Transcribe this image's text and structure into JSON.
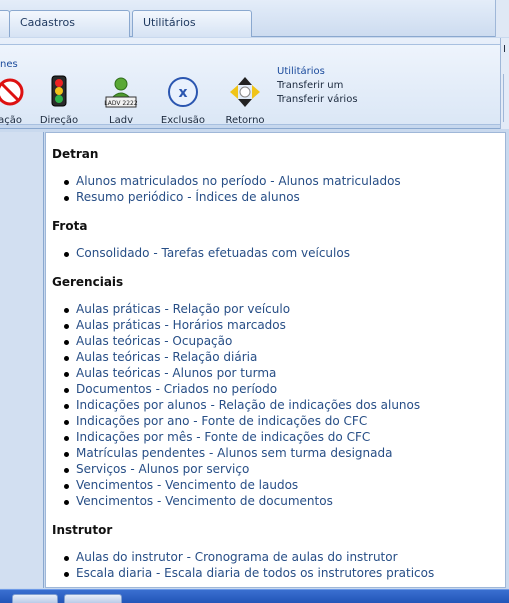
{
  "tabs": [
    {
      "label": ""
    },
    {
      "label": "Cadastros"
    },
    {
      "label": "Utilitários"
    }
  ],
  "ribbon": {
    "group_title_partial": "nes",
    "buttons": [
      {
        "label": "ação",
        "icon": "prohibited-icon"
      },
      {
        "label": "Direção",
        "icon": "traffic-light-icon"
      },
      {
        "label": "Ladv",
        "icon": "license-user-icon",
        "plate_text": "LADV 2222"
      },
      {
        "label": "Exclusão",
        "icon": "exclude-x-icon"
      },
      {
        "label": "Retorno",
        "icon": "return-arrows-icon"
      }
    ],
    "utilities": {
      "title": "Utilitários",
      "items": [
        "Transferir um",
        "Transferir vários"
      ]
    },
    "right_group_partial": "I"
  },
  "sections": [
    {
      "title": "Detran",
      "items": [
        "Alunos matriculados no período - Alunos matriculados",
        "Resumo periódico - Índices de alunos"
      ]
    },
    {
      "title": "Frota",
      "items": [
        "Consolidado - Tarefas efetuadas com veículos"
      ]
    },
    {
      "title": "Gerenciais",
      "items": [
        "Aulas práticas - Relação por veículo",
        "Aulas práticas - Horários marcados",
        "Aulas teóricas - Ocupação",
        "Aulas teóricas - Relação diária",
        "Aulas teóricas - Alunos por turma",
        "Documentos - Criados no período",
        "Indicações por alunos - Relação de indicações dos alunos",
        "Indicações por ano - Fonte de indicações do CFC",
        "Indicações por mês - Fonte de indicações do CFC",
        "Matrículas pendentes - Alunos sem turma designada",
        "Serviços - Alunos por serviço",
        "Vencimentos - Vencimento de laudos",
        "Vencimentos - Vencimento de documentos"
      ]
    },
    {
      "title": "Instrutor",
      "items": [
        "Aulas do instrutor - Cronograma de aulas do instrutor",
        "Escala diaria - Escala diaria de todos os instrutores praticos"
      ]
    }
  ],
  "colors": {
    "link": "#274e86",
    "heading": "#111111",
    "ribbon_accent": "#1a4a9c",
    "taskbar": "#2255b8"
  }
}
